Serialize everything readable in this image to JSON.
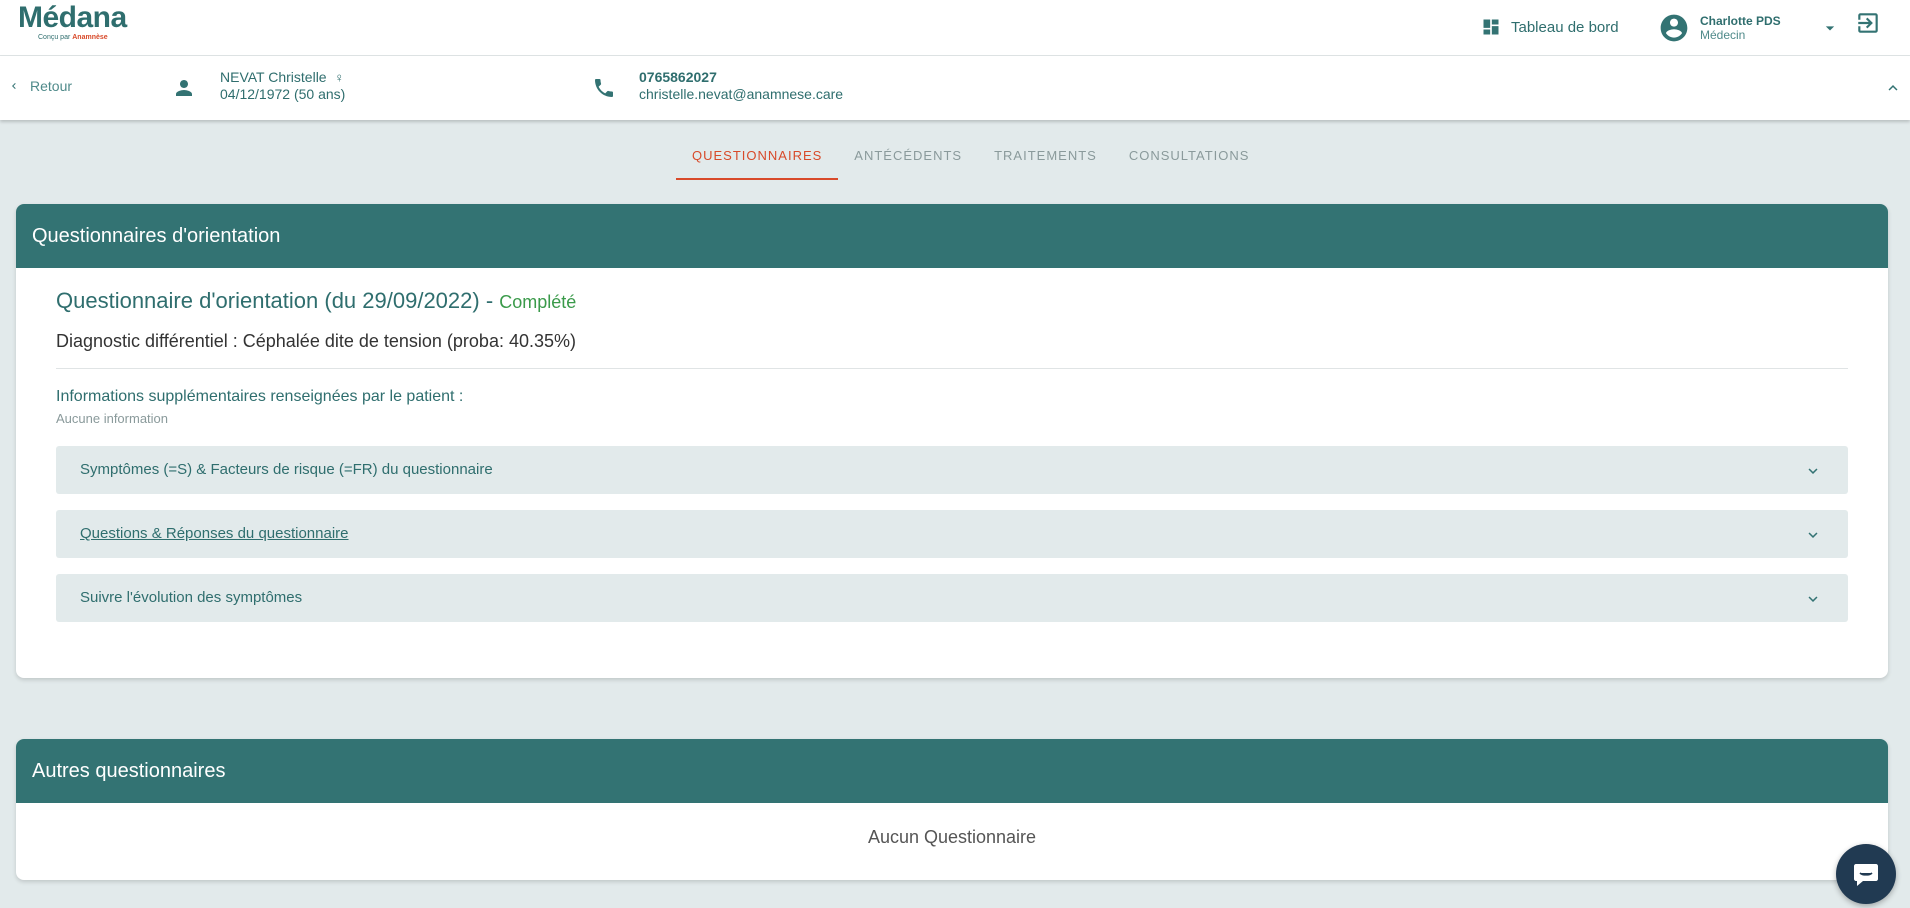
{
  "app": {
    "logo_text": "Médana",
    "logo_sub_prefix": "Conçu par ",
    "logo_sub_brand": "Anamnèse"
  },
  "topbar": {
    "dashboard_label": "Tableau de bord",
    "user_name": "Charlotte PDS",
    "user_role": "Médecin"
  },
  "patient": {
    "back_label": "Retour",
    "name": "NEVAT Christelle",
    "gender_symbol": "♀",
    "dob": "04/12/1972 (50 ans)",
    "phone": "0765862027",
    "email": "christelle.nevat@anamnese.care"
  },
  "tabs": [
    {
      "label": "QUESTIONNAIRES",
      "active": true
    },
    {
      "label": "ANTÉCÉDENTS",
      "active": false
    },
    {
      "label": "TRAITEMENTS",
      "active": false
    },
    {
      "label": "CONSULTATIONS",
      "active": false
    }
  ],
  "orientation": {
    "header": "Questionnaires d'orientation",
    "title": "Questionnaire d'orientation (du 29/09/2022) - ",
    "status": "Complété",
    "diagnostic": "Diagnostic différentiel : Céphalée dite de tension (proba: 40.35%)",
    "info_label": "Informations supplémentaires renseignées par le patient :",
    "info_value": "Aucune information",
    "accordions": [
      {
        "label": "Symptômes (=S) & Facteurs de risque (=FR) du questionnaire"
      },
      {
        "label": "Questions & Réponses du questionnaire"
      },
      {
        "label": "Suivre l'évolution des symptômes"
      }
    ]
  },
  "others": {
    "header": "Autres questionnaires",
    "empty_message": "Aucun Questionnaire"
  },
  "colors": {
    "primary": "#337373",
    "accent": "#d84a2a",
    "success": "#3a9a4a",
    "background": "#e2eaeb"
  }
}
